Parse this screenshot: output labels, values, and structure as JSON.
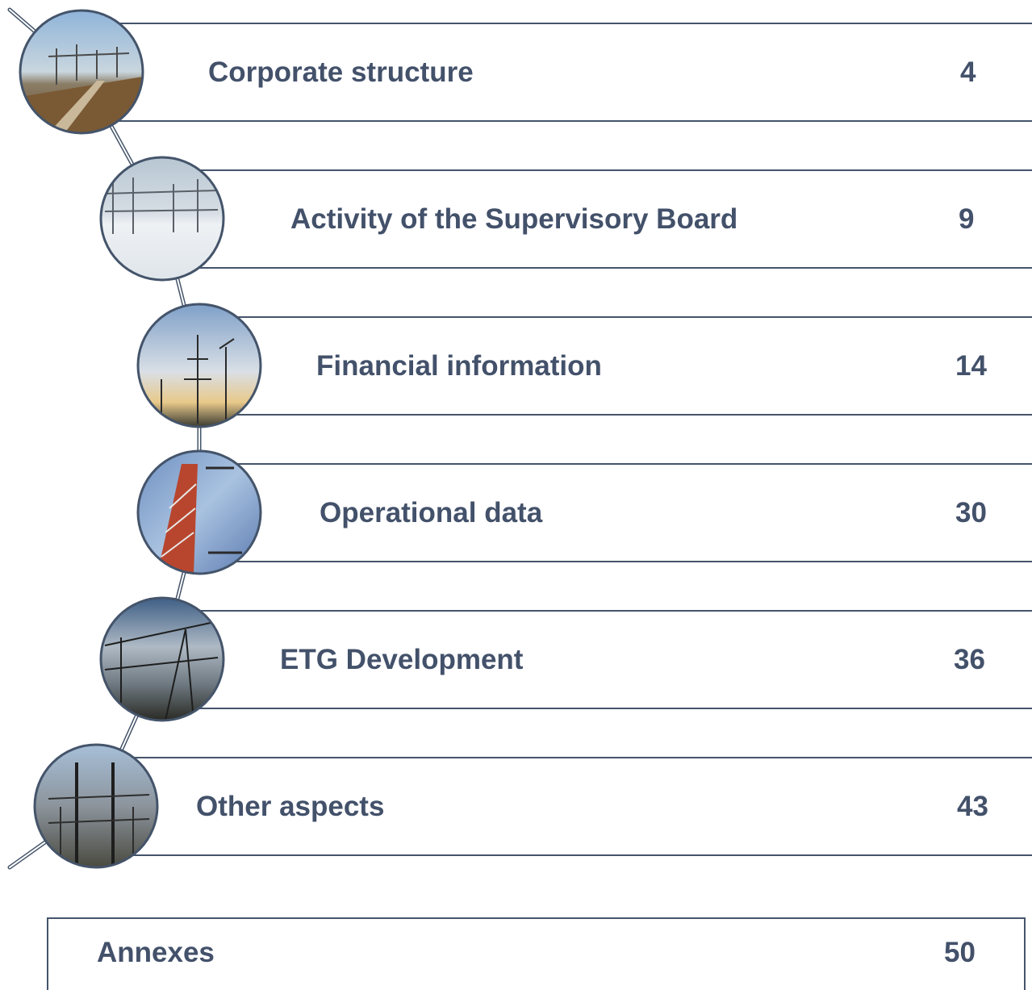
{
  "toc": {
    "items": [
      {
        "label": "Corporate structure",
        "page": "4"
      },
      {
        "label": "Activity of the Supervisory Board",
        "page": "9"
      },
      {
        "label": "Financial information",
        "page": "14"
      },
      {
        "label": "Operational data",
        "page": "30"
      },
      {
        "label": "ETG Development",
        "page": "36"
      },
      {
        "label": "Other aspects",
        "page": "43"
      }
    ],
    "annex": {
      "label": "Annexes",
      "page": "50"
    }
  },
  "colors": {
    "text": "#43516a",
    "border": "#44546a"
  },
  "icons": [
    "substation-photo",
    "snowy-substation-photo",
    "power-pylon-sky-photo",
    "lattice-tower-photo",
    "power-lines-clouds-photo",
    "switchyard-photo"
  ]
}
